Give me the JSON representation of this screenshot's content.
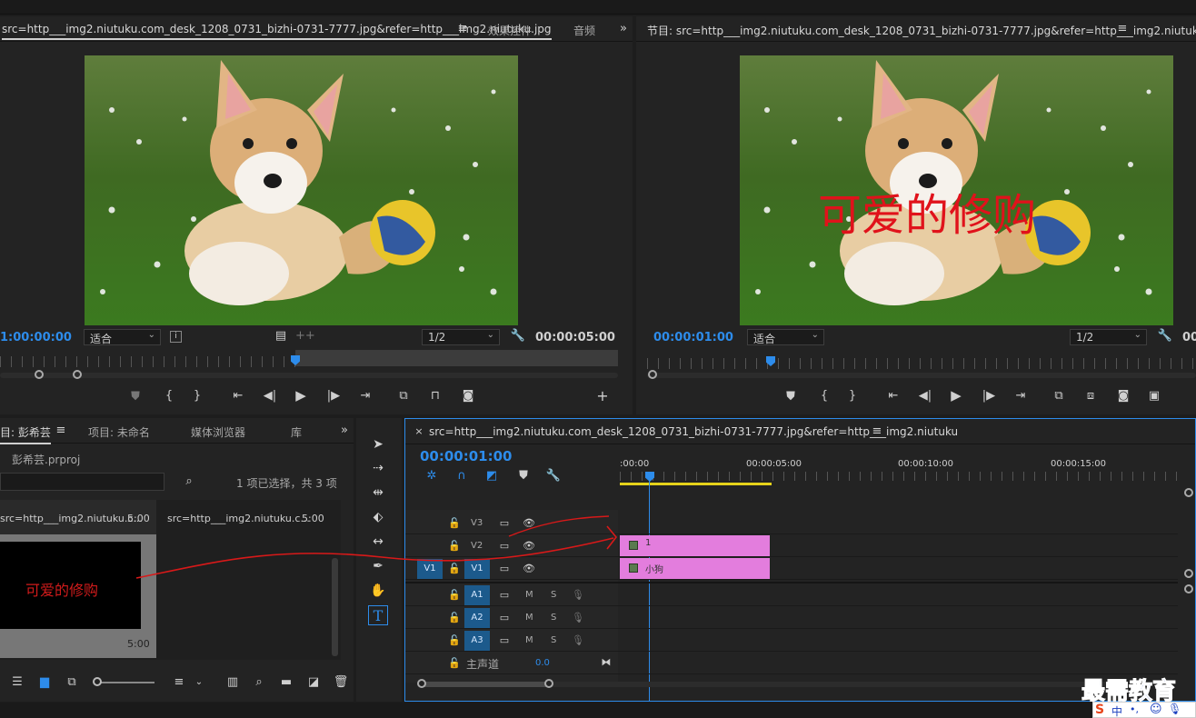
{
  "source_monitor": {
    "tabs": [
      {
        "label": "src=http___img2.niutuku.com_desk_1208_0731_bizhi-0731-7777.jpg&refer=http___img2.niutuku.jpg"
      },
      {
        "label": "效果控件"
      },
      {
        "label": "音频"
      }
    ],
    "timecode_left": "1:00:00:00",
    "fit_label": "适合",
    "resolution_label": "1/2",
    "timecode_right": "00:00:05:00"
  },
  "program_monitor": {
    "title": "节目: src=http___img2.niutuku.com_desk_1208_0731_bizhi-0731-7777.jpg&refer=http___img2.niutuku",
    "timecode_left": "00:00:01:00",
    "fit_label": "适合",
    "resolution_label": "1/2",
    "timecode_right": "00",
    "overlay_text": "可爱的修购",
    "overlay_color": "#e0121b"
  },
  "project_panel": {
    "tabs": [
      {
        "label": "目: 彭希芸"
      },
      {
        "label": "项目: 未命名"
      },
      {
        "label": "媒体浏览器"
      },
      {
        "label": "库"
      }
    ],
    "project_file": "彭希芸.prproj",
    "selection_status": "1 项已选择，共 3 项",
    "items": [
      {
        "name": "src=http___img2.niutuku.c...",
        "duration": "5:00"
      },
      {
        "name": "src=http___img2.niutuku.c...",
        "duration": "5:00"
      }
    ],
    "thumb_title_text": "可爱的修购",
    "thumb_duration": "5:00"
  },
  "timeline": {
    "sequence_name": "src=http___img2.niutuku.com_desk_1208_0731_bizhi-0731-7777.jpg&refer=http___img2.niutuku",
    "timecode": "00:00:01:00",
    "ruler_labels": [
      ":00:00",
      "00:00:05:00",
      "00:00:10:00",
      "00:00:15:00"
    ],
    "video_tracks": [
      {
        "name": "V3"
      },
      {
        "name": "V2"
      },
      {
        "name": "V1",
        "source": "V1"
      }
    ],
    "audio_tracks": [
      {
        "name": "A1"
      },
      {
        "name": "A2"
      },
      {
        "name": "A3"
      }
    ],
    "master_label": "主声道",
    "master_value": "0.0",
    "clips": [
      {
        "label": "1",
        "track": "V2"
      },
      {
        "label": "小狗",
        "track": "V1"
      }
    ],
    "clip_color": "#e37ddd",
    "mute_label": "M",
    "solo_label": "S"
  },
  "watermark": {
    "text": "最需教育",
    "ime_text": "中",
    "ime_extra": "•,"
  },
  "colors": {
    "accent_blue": "#2d8ceb",
    "work_area_yellow": "#e5d21b"
  }
}
